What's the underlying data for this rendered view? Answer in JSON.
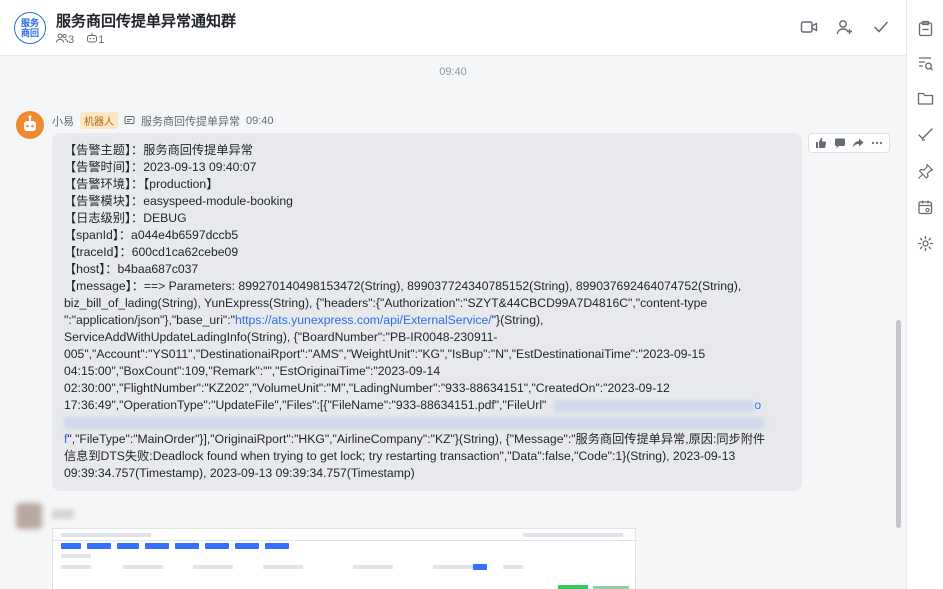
{
  "header": {
    "avatar_text": "服务\n商回",
    "title": "服务商回传提单异常通知群",
    "member_count": "3",
    "bot_count": "1"
  },
  "timestamp": "09:40",
  "message": {
    "sender": "小易",
    "sender_tag": "机器人",
    "source": "服务商回传提单异常",
    "time": "09:40",
    "lines": [
      "【告警主题】：服务商回传提单异常",
      "【告警时间】：2023-09-13 09:40:07",
      "【告警环境】：【production】",
      "【告警模块】：easyspeed-module-booking",
      "【日志级别】：DEBUG",
      "【spanId】：a044e4b6597dccb5",
      "【traceId】：600cd1ca62cebe09",
      "【host】：b4baa687c037",
      "【message】：==> Parameters: 899270140498153472(String), 899037724340785152(String), 899037692464074752(String),",
      "biz_bill_of_lading(String), YunExpress(String), {\"headers\":{\"Authorization\":\"SZYT&44CBCD99A7D4816C\",\"content-type",
      "\":\"application/json\"},\"base_uri\":\"",
      "ServiceAddWithUpdateLadingInfo(String), {\"BoardNumber\":\"PB-IR0048-230911-",
      "005\",\"Account\":\"YS011\",\"DestinationaiRport\":\"AMS\",\"WeightUnit\":\"KG\",\"IsBup\":\"N\",\"EstDestinationaiTime\":\"2023-09-15",
      "04:15:00\",\"BoxCount\":109,\"Remark\":\"\",\"EstOriginaiTime\":\"2023-09-14",
      "02:30:00\",\"FlightNumber\":\"KZ202\",\"VolumeUnit\":\"M\",\"LadingNumber\":\"933-88634151\",\"CreatedOn\":\"2023-09-12",
      "17:36:49\",\"OperationType\":\"UpdateFile\",\"Files\":[{\"FileName\":\"933-88634151.pdf\",\"FileUrl\"",
      "\",\"FileType\":\"MainOrder\"}],\"OriginaiRport\":\"HKG\",\"AirlineCompany\":\"KZ\"}(String), {\"Message\":\"服务商回传提单异常,原因:同步附件",
      "信息到DTS失败:Deadlock found when trying to get lock; try restarting transaction\",\"Data\":false,\"Code\":1}(String), 2023-09-13",
      "09:39:34.757(Timestamp), 2023-09-13 09:39:34.757(Timestamp)"
    ],
    "link": "https://ats.yunexpress.com/api/ExternalService/",
    "after_link": "\"}(String),",
    "url_tail": "o",
    "url_head": "f"
  }
}
